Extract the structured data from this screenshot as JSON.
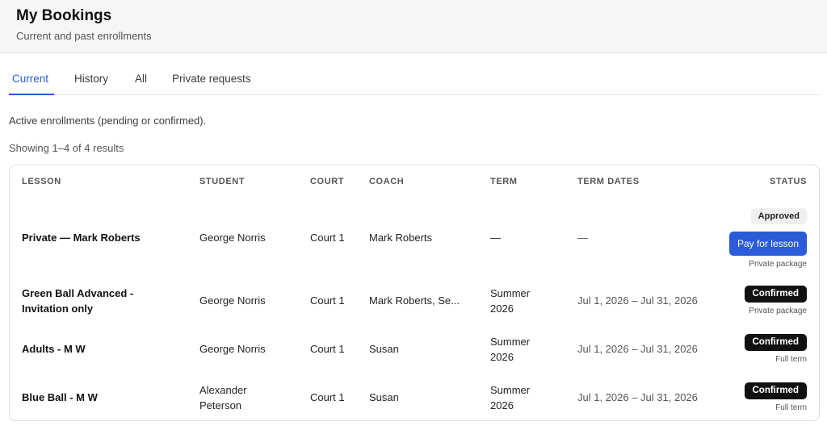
{
  "header": {
    "title": "My Bookings",
    "subtitle": "Current and past enrollments"
  },
  "tabs": [
    {
      "label": "Current",
      "active": true
    },
    {
      "label": "History",
      "active": false
    },
    {
      "label": "All",
      "active": false
    },
    {
      "label": "Private requests",
      "active": false
    }
  ],
  "description": "Active enrollments (pending or confirmed).",
  "results_count": "Showing 1–4 of 4 results",
  "table": {
    "columns": {
      "lesson": "LESSON",
      "student": "STUDENT",
      "court": "COURT",
      "coach": "COACH",
      "term": "TERM",
      "term_dates": "TERM DATES",
      "status": "STATUS"
    },
    "rows": [
      {
        "lesson": [
          "Private — Mark Roberts"
        ],
        "student": [
          "George Norris"
        ],
        "court": "Court 1",
        "coach": "Mark Roberts",
        "term": [
          "—"
        ],
        "term_dates": "—",
        "status_badge": "Approved",
        "action": "Pay for lesson",
        "note": "Private package"
      },
      {
        "lesson": [
          "Green Ball Advanced -",
          "Invitation only"
        ],
        "student": [
          "George Norris"
        ],
        "court": "Court 1",
        "coach": "Mark Roberts, Se...",
        "term": [
          "Summer",
          "2026"
        ],
        "term_dates": "Jul 1, 2026 – Jul 31, 2026",
        "status_badge": "Confirmed",
        "note": "Private package"
      },
      {
        "lesson": [
          "Adults - M W"
        ],
        "student": [
          "George Norris"
        ],
        "court": "Court 1",
        "coach": "Susan",
        "term": [
          "Summer",
          "2026"
        ],
        "term_dates": "Jul 1, 2026 – Jul 31, 2026",
        "status_badge": "Confirmed",
        "note": "Full term"
      },
      {
        "lesson": [
          "Blue Ball - M W"
        ],
        "student": [
          "Alexander",
          "Peterson"
        ],
        "court": "Court 1",
        "coach": "Susan",
        "term": [
          "Summer",
          "2026"
        ],
        "term_dates": "Jul 1, 2026 – Jul 31, 2026",
        "status_badge": "Confirmed",
        "note": "Full term"
      }
    ]
  },
  "colors": {
    "accent": "#2b5bd7",
    "badge_dark": "#111111",
    "badge_light": "#efefef"
  }
}
